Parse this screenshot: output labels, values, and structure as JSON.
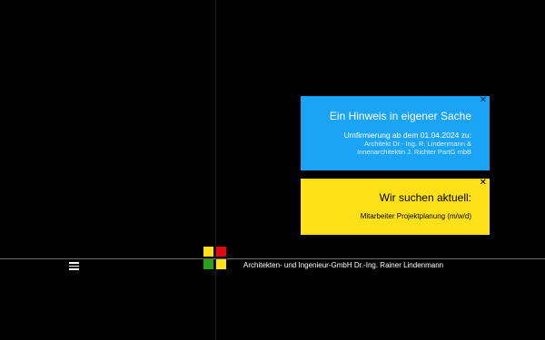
{
  "notice_blue": {
    "title": "Ein Hinweis in eigener Sache",
    "line1": "Umfirmierung ab dem 01.04.2024 zu:",
    "line2": "Architekt Dr.- Ing. R. Lindenmann &",
    "line3": "Innenarchitektin J. Richter PartG mbB",
    "close_label": "✕",
    "color": "#1ba4f5"
  },
  "notice_yellow": {
    "title": "Wir suchen aktuell:",
    "subtitle": "Mitarbeiter Projektplanung (m/w/d)",
    "close_label": "✕",
    "color": "#ffe11a"
  },
  "footer": {
    "company": "Architekten- und Ingenieur-GmbH  Dr.-Ing. Rainer Lindenmann",
    "menu_icon": "hamburger-menu-icon",
    "logo_colors": [
      "#ffe11a",
      "#e30613",
      "#2aa11b",
      "#ffe11a"
    ]
  }
}
